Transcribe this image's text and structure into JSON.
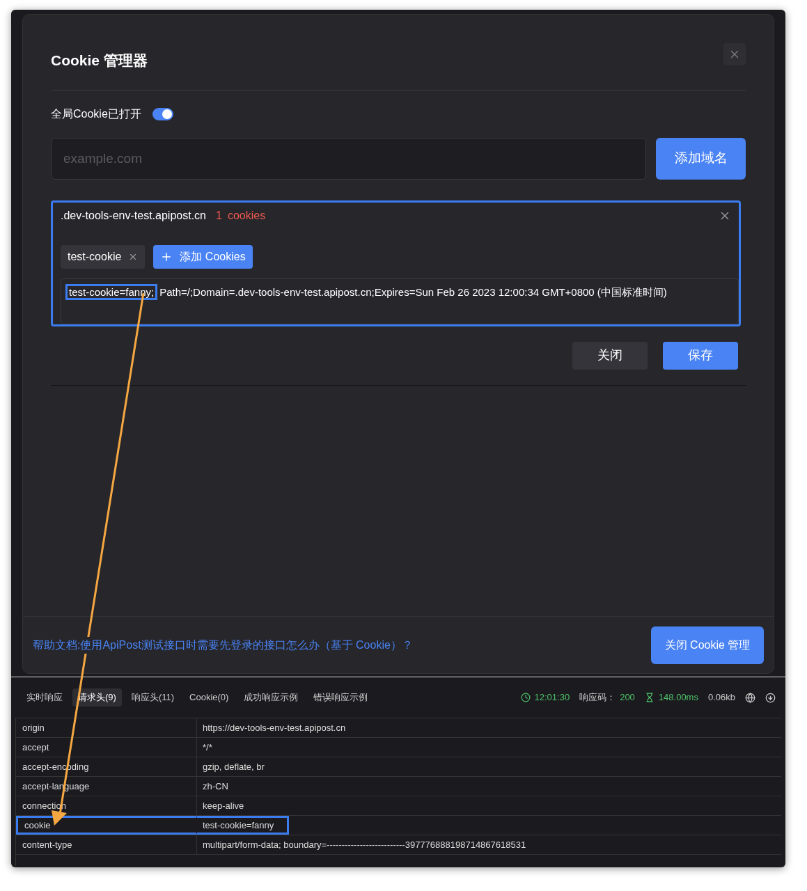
{
  "modal": {
    "title": "Cookie 管理器",
    "toggle": {
      "label": "全局Cookie已打开",
      "on": true
    },
    "domain_input": {
      "placeholder": "example.com"
    },
    "add_domain_button": "添加域名",
    "domain_card": {
      "highlighted": true,
      "domain": ".dev-tools-env-test.apipost.cn",
      "count": "1",
      "count_label": "cookies",
      "cookie_tags": [
        {
          "label": "test-cookie",
          "selected": true
        }
      ],
      "add_cookie_button": "添加 Cookies",
      "cookie_value": {
        "highlighted_part": "test-cookie=fanny;",
        "rest": "Path=/;Domain=.dev-tools-env-test.apipost.cn;Expires=Sun Feb 26 2023 12:00:34 GMT+0800 (中国标准时间)"
      }
    },
    "buttons": [
      {
        "label": "关闭",
        "kind": "secondary"
      },
      {
        "label": "保存",
        "kind": "primary"
      }
    ],
    "help_link": "帮助文档:使用ApiPost测试接口时需要先登录的接口怎么办（基于 Cookie）？",
    "close_manager_button": "关闭 Cookie 管理"
  },
  "response_panel": {
    "tabs": [
      {
        "label": "实时响应",
        "selected": false
      },
      {
        "label": "请求头(9)",
        "selected": true
      },
      {
        "label": "响应头(11)",
        "selected": false
      },
      {
        "label": "Cookie(0)",
        "selected": false
      },
      {
        "label": "成功响应示例",
        "selected": false
      },
      {
        "label": "错误响应示例",
        "selected": false
      }
    ],
    "status": {
      "time": "12:01:30",
      "code_label": "响应码：",
      "code": "200",
      "duration": "148.00ms",
      "size": "0.06kb"
    },
    "headers": [
      {
        "name": "origin",
        "value": "https://dev-tools-env-test.apipost.cn",
        "highlighted": false
      },
      {
        "name": "accept",
        "value": "*/*",
        "highlighted": false
      },
      {
        "name": "accept-encoding",
        "value": "gzip, deflate, br",
        "highlighted": false
      },
      {
        "name": "accept-language",
        "value": "zh-CN",
        "highlighted": false
      },
      {
        "name": "connection",
        "value": "keep-alive",
        "highlighted": false
      },
      {
        "name": "cookie",
        "value": "test-cookie=fanny",
        "highlighted": true
      },
      {
        "name": "content-type",
        "value": "multipart/form-data; boundary=--------------------------397776888198714867618531",
        "highlighted": false
      }
    ]
  }
}
